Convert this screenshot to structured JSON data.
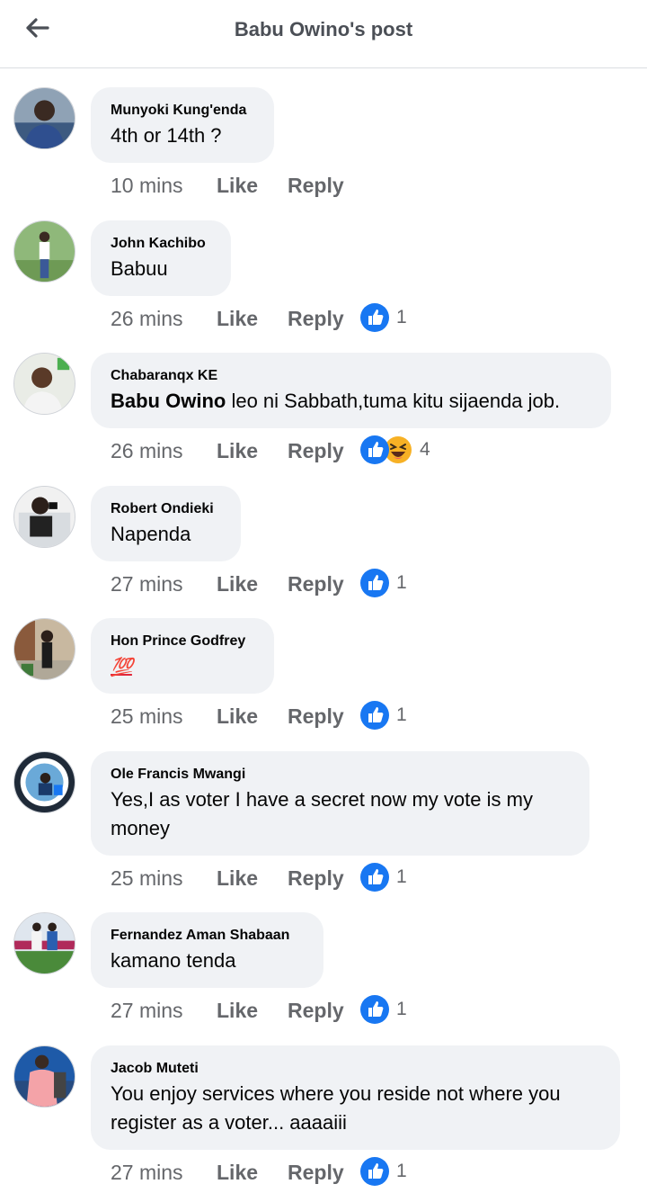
{
  "header": {
    "title": "Babu Owino's post"
  },
  "colors": {
    "like_blue": "#1877f2",
    "haha_yellow": "#f7b125",
    "bubble_bg": "#f0f2f5",
    "meta_gray": "#65676b"
  },
  "action_labels": {
    "like": "Like",
    "reply": "Reply"
  },
  "comments": [
    {
      "author": "Munyoki Kung'enda",
      "text": "4th or 14th ?",
      "time": "10 mins",
      "reactions": null
    },
    {
      "author": "John Kachibo",
      "text": "Babuu",
      "time": "26 mins",
      "reactions": {
        "icons": [
          "like-icon"
        ],
        "count": "1"
      }
    },
    {
      "author": "Chabaranqx KE",
      "mention": "Babu Owino",
      "text": " leo ni Sabbath,tuma kitu sijaenda job.",
      "time": "26 mins",
      "reactions": {
        "icons": [
          "like-icon",
          "haha-icon"
        ],
        "count": "4"
      }
    },
    {
      "author": "Robert Ondieki",
      "text": "Napenda",
      "time": "27 mins",
      "reactions": {
        "icons": [
          "like-icon"
        ],
        "count": "1"
      }
    },
    {
      "author": "Hon Prince Godfrey",
      "text": "💯",
      "time": "25 mins",
      "reactions": {
        "icons": [
          "like-icon"
        ],
        "count": "1"
      }
    },
    {
      "author": "Ole Francis Mwangi",
      "text_lines": [
        "Yes,I as voter I have a secret now my vote is my",
        "money"
      ],
      "time": "25 mins",
      "reactions": {
        "icons": [
          "like-icon"
        ],
        "count": "1"
      }
    },
    {
      "author": "Fernandez Aman Shabaan",
      "text": "kamano tenda",
      "time": "27 mins",
      "reactions": {
        "icons": [
          "like-icon"
        ],
        "count": "1"
      }
    },
    {
      "author": "Jacob Muteti",
      "text_lines": [
        "You enjoy services where you reside not where you",
        "register as a voter... aaaaiii"
      ],
      "time": "27 mins",
      "reactions": {
        "icons": [
          "like-icon"
        ],
        "count": "1"
      }
    }
  ]
}
